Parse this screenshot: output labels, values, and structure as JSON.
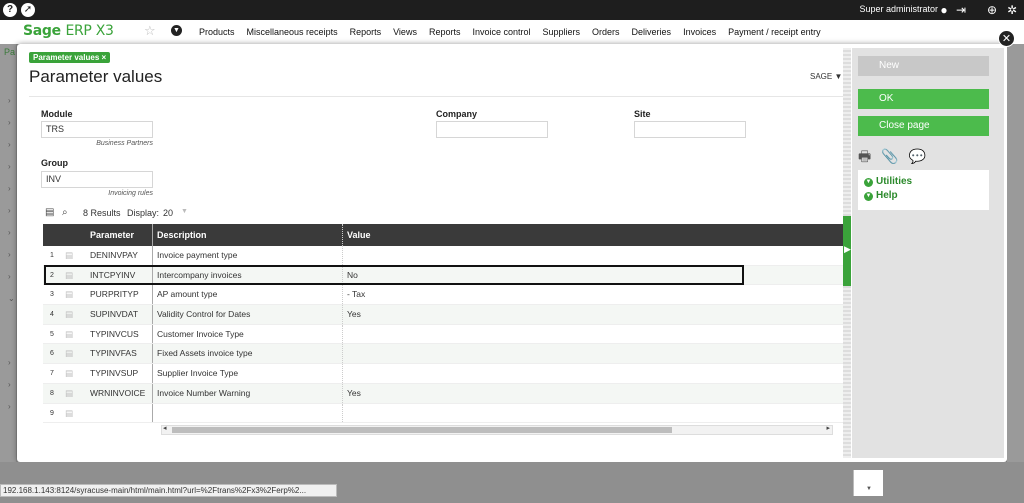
{
  "topbar": {
    "help_icon": "question-icon",
    "rocket_icon": "rocket-icon",
    "user": "Super administrator",
    "user_icon": "user-icon",
    "logout_icon": "logout-icon",
    "globe_icon": "globe-icon",
    "settings_icon": "gear-icon"
  },
  "menubar": {
    "logo_main": "Sage",
    "logo_sub": "ERP X3",
    "items": [
      "Products",
      "Miscellaneous receipts",
      "Reports",
      "Views",
      "Reports",
      "Invoice control",
      "Suppliers",
      "Orders",
      "Deliveries",
      "Invoices",
      "Payment / receipt entry"
    ]
  },
  "background": {
    "left_prefix": "Pa"
  },
  "page": {
    "tag": "Parameter values",
    "title": "Parameter values",
    "folder": "SAGE"
  },
  "form": {
    "module": {
      "label": "Module",
      "value": "TRS",
      "hint": "Business Partners"
    },
    "company": {
      "label": "Company",
      "value": ""
    },
    "site": {
      "label": "Site",
      "value": ""
    },
    "group": {
      "label": "Group",
      "value": "INV",
      "hint": "Invoicing rules"
    }
  },
  "table": {
    "results": "8 Results",
    "display_label": "Display:",
    "display_value": "20",
    "headers": {
      "parameter": "Parameter",
      "description": "Description",
      "value": "Value"
    },
    "rows": [
      {
        "num": "1",
        "parameter": "DENINVPAY",
        "description": "Invoice payment type",
        "value": ""
      },
      {
        "num": "2",
        "parameter": "INTCPYINV",
        "description": "Intercompany invoices",
        "value": "No"
      },
      {
        "num": "3",
        "parameter": "PURPRITYP",
        "description": "AP amount type",
        "value": "- Tax"
      },
      {
        "num": "4",
        "parameter": "SUPINVDAT",
        "description": "Validity Control for Dates",
        "value": "Yes"
      },
      {
        "num": "5",
        "parameter": "TYPINVCUS",
        "description": "Customer Invoice Type",
        "value": ""
      },
      {
        "num": "6",
        "parameter": "TYPINVFAS",
        "description": "Fixed Assets invoice type",
        "value": ""
      },
      {
        "num": "7",
        "parameter": "TYPINVSUP",
        "description": "Supplier Invoice Type",
        "value": ""
      },
      {
        "num": "8",
        "parameter": "WRNINVOICE",
        "description": "Invoice Number Warning",
        "value": "Yes"
      },
      {
        "num": "9",
        "parameter": "",
        "description": "",
        "value": ""
      }
    ]
  },
  "actions": {
    "new": "New",
    "ok": "OK",
    "close": "Close page",
    "utilities": "Utilities",
    "help": "Help"
  },
  "status_url": "192.168.1.143:8124/syracuse-main/html/main.html?url=%2Ftrans%2Fx3%2Ferp%2..."
}
